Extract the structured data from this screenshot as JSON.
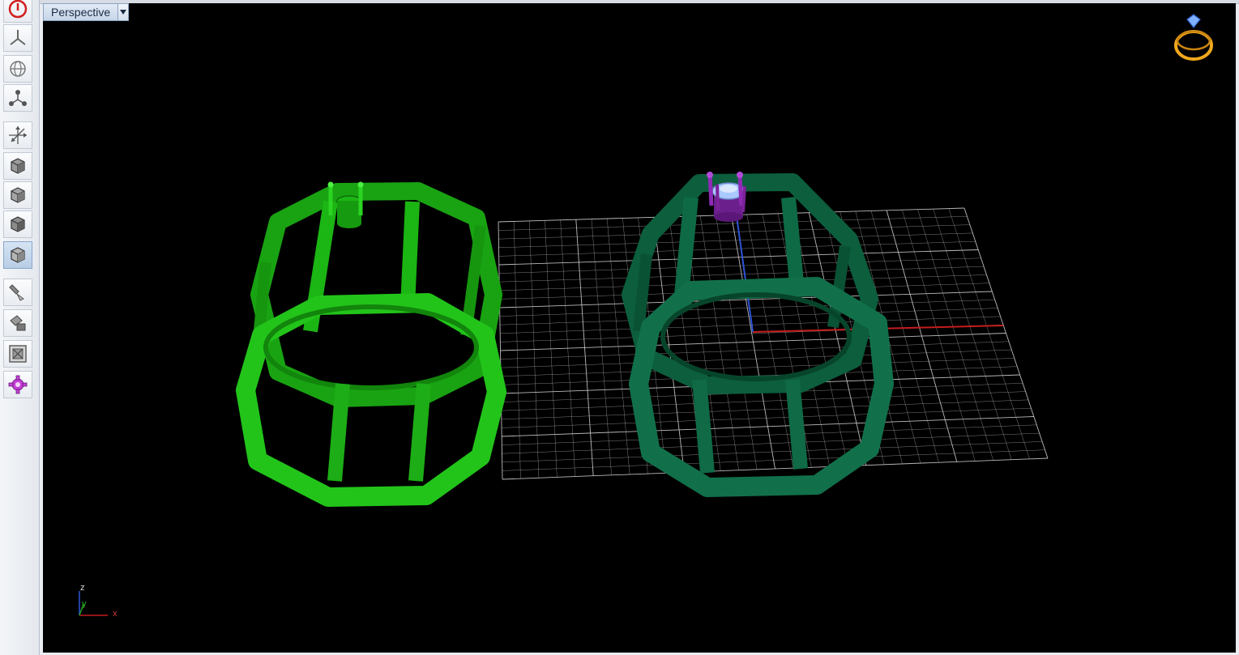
{
  "viewport": {
    "name": "Perspective",
    "dropdown_icon": "chevron-down-icon",
    "background": "#000000"
  },
  "toolbar": {
    "buttons": [
      {
        "name": "power-button",
        "icon": "power-icon"
      },
      {
        "name": "top-view-button",
        "icon": "view-top-icon"
      },
      {
        "name": "globe-view-button",
        "icon": "globe-icon"
      },
      {
        "name": "nodes-button",
        "icon": "nodes-icon"
      },
      {
        "name": "axes-button",
        "icon": "axes-icon"
      },
      {
        "name": "shade-mode-1-button",
        "icon": "cube-icon"
      },
      {
        "name": "shade-mode-2-button",
        "icon": "cube-icon"
      },
      {
        "name": "shade-mode-3-button",
        "icon": "cube-icon"
      },
      {
        "name": "shade-mode-4-button",
        "icon": "cube-icon",
        "active": true
      },
      {
        "name": "render-tool-1-button",
        "icon": "brush-icon"
      },
      {
        "name": "render-tool-2-button",
        "icon": "paint-icon"
      },
      {
        "name": "zoom-extents-button",
        "icon": "zoom-extents-icon"
      },
      {
        "name": "settings-button",
        "icon": "gear-icon"
      }
    ]
  },
  "axis_triad": {
    "z": "z",
    "y": "y",
    "x": "x"
  },
  "corner_icon": "ring-icon",
  "colors": {
    "object_bright_green": "#22c41a",
    "object_dark_green": "#0f6e48",
    "grid": "#cfcfcf",
    "axis_x": "#c41c1c",
    "axis_y": "#1f9a1f",
    "axis_z": "#2d55d8",
    "gem": "#a9c9ff",
    "prongs": "#8e2ab5",
    "ring_icon": "#f0a81c"
  }
}
